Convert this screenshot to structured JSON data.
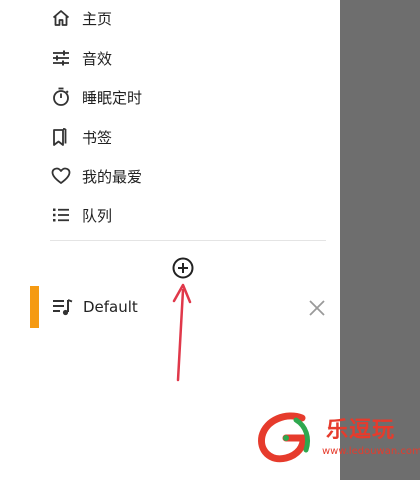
{
  "menu": {
    "items": [
      {
        "label": "主页",
        "icon": "home-icon"
      },
      {
        "label": "音效",
        "icon": "equalizer-icon"
      },
      {
        "label": "睡眠定时",
        "icon": "sleep-timer-icon"
      },
      {
        "label": "书签",
        "icon": "bookmark-icon"
      },
      {
        "label": "我的最爱",
        "icon": "heart-icon"
      },
      {
        "label": "队列",
        "icon": "queue-icon"
      }
    ]
  },
  "playlists": {
    "add_icon": "add-circle-icon",
    "items": [
      {
        "label": "Default",
        "icon": "playlist-music-icon",
        "remove_icon": "close-icon"
      }
    ]
  },
  "watermark": {
    "brand": "乐逗玩",
    "url": "www.ledouwan.com"
  },
  "colors": {
    "accent": "#f59a12",
    "scrim": "#6e6e6e",
    "annotation_arrow": "#e0384a",
    "watermark_red": "#e63b2c",
    "watermark_green": "#2fa84f"
  }
}
